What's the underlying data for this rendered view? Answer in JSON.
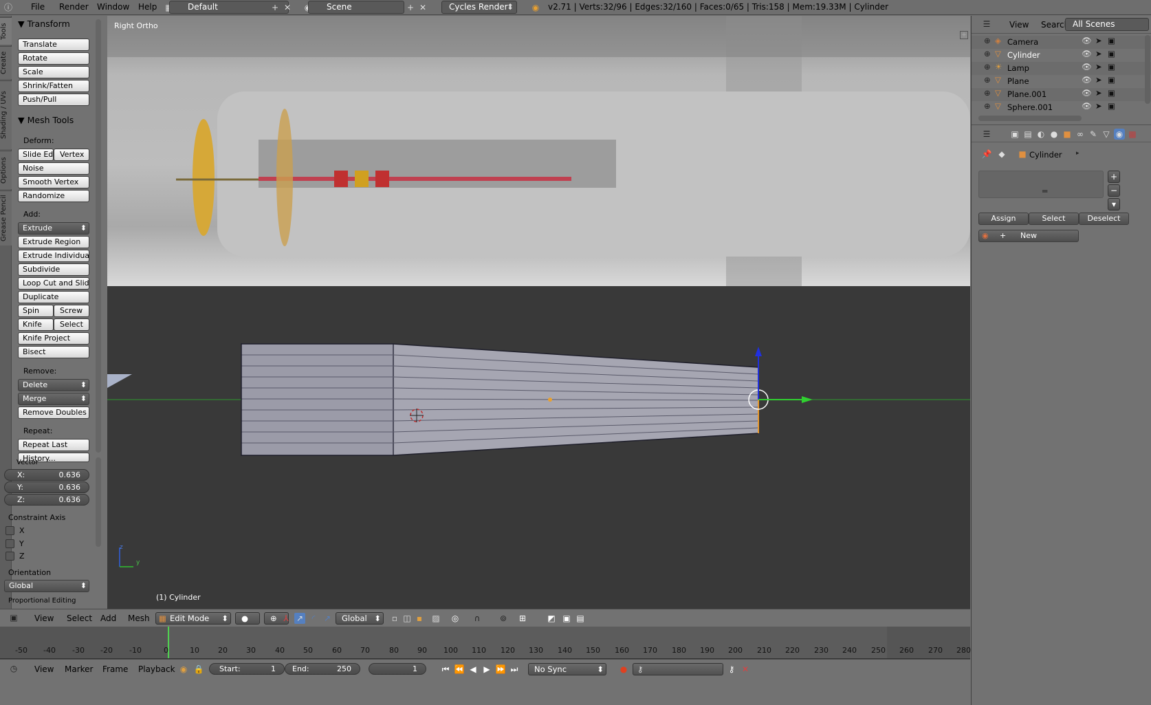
{
  "topbar": {
    "menus": [
      "File",
      "Render",
      "Window",
      "Help"
    ],
    "screen_layout": "Default",
    "scene": "Scene",
    "engine": "Cycles Render",
    "stats": "v2.71 | Verts:32/96 | Edges:32/160 | Faces:0/65 | Tris:158 | Mem:19.33M | Cylinder"
  },
  "left_tabs": [
    "Tools",
    "Create",
    "Shading / UVs",
    "Options",
    "Grease Pencil"
  ],
  "toolshelf": {
    "transform_header": "Transform",
    "transform": [
      "Translate",
      "Rotate",
      "Scale",
      "Shrink/Fatten",
      "Push/Pull"
    ],
    "meshtools_header": "Mesh Tools",
    "deform_label": "Deform:",
    "slide_edge": "Slide Ed",
    "vertex": "Vertex",
    "noise": "Noise",
    "smooth_vertex": "Smooth Vertex",
    "randomize": "Randomize",
    "add_label": "Add:",
    "extrude": "Extrude",
    "extrude_region": "Extrude Region",
    "extrude_individual": "Extrude Individual",
    "subdivide": "Subdivide",
    "loop_cut": "Loop Cut and Slide",
    "duplicate": "Duplicate",
    "spin": "Spin",
    "screw": "Screw",
    "knife": "Knife",
    "select": "Select",
    "knife_project": "Knife Project",
    "bisect": "Bisect",
    "remove_label": "Remove:",
    "delete": "Delete",
    "merge": "Merge",
    "remove_doubles": "Remove Doubles",
    "repeat_label": "Repeat:",
    "repeat_last": "Repeat Last",
    "history": "History...",
    "vector_label": "Vector",
    "x_label": "X:",
    "x_val": "0.636",
    "y_label": "Y:",
    "y_val": "0.636",
    "z_label": "Z:",
    "z_val": "0.636",
    "constraint_label": "Constraint Axis",
    "cx": "X",
    "cy": "Y",
    "cz": "Z",
    "orientation_label": "Orientation",
    "orientation_val": "Global",
    "proportional_label": "Proportional Editing"
  },
  "viewport": {
    "view_name": "Right Ortho",
    "object_label": "(1) Cylinder",
    "axis_z": "z",
    "axis_y": "y"
  },
  "outliner": {
    "menus": [
      "View",
      "Search"
    ],
    "filter": "All Scenes",
    "items": [
      "Camera",
      "Cylinder",
      "Lamp",
      "Plane",
      "Plane.001",
      "Sphere.001"
    ]
  },
  "properties": {
    "breadcrumb": "Cylinder",
    "assign": "Assign",
    "select": "Select",
    "deselect": "Deselect",
    "new": "New"
  },
  "viewport_header": {
    "menus": [
      "View",
      "Select",
      "Add",
      "Mesh"
    ],
    "mode": "Edit Mode",
    "orientation": "Global"
  },
  "timeline": {
    "ticks": [
      "-50",
      "-40",
      "-30",
      "-20",
      "-10",
      "0",
      "10",
      "20",
      "30",
      "40",
      "50",
      "60",
      "70",
      "80",
      "90",
      "100",
      "110",
      "120",
      "130",
      "140",
      "150",
      "160",
      "170",
      "180",
      "190",
      "200",
      "210",
      "220",
      "230",
      "240",
      "250",
      "260",
      "270",
      "280"
    ],
    "current_frame": 1
  },
  "timeline_header": {
    "menus": [
      "View",
      "Marker",
      "Frame",
      "Playback"
    ],
    "start_label": "Start:",
    "start_val": "1",
    "end_label": "End:",
    "end_val": "250",
    "frame_val": "1",
    "sync": "No Sync"
  }
}
